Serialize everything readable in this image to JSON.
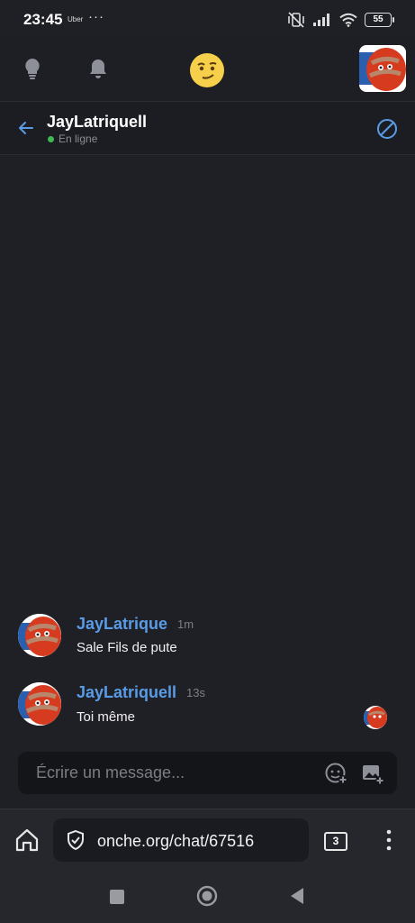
{
  "status_bar": {
    "time": "23:45",
    "carrier": "Uber",
    "more": "···",
    "battery": "55"
  },
  "top_bar": {
    "icons": [
      "lightbulb-icon",
      "bell-icon",
      "site-logo-emoji",
      "user-avatar"
    ]
  },
  "chat_header": {
    "title": "JayLatriquell",
    "status": "En ligne",
    "status_color": "#3fb950",
    "accent": "#5a9be6"
  },
  "messages": [
    {
      "author": "JayLatrique",
      "time": "1m",
      "text": "Sale Fils de pute"
    },
    {
      "author": "JayLatriquell",
      "time": "13s",
      "text": "Toi même"
    }
  ],
  "composer": {
    "placeholder": "Écrire un message..."
  },
  "browser": {
    "url": "onche.org/chat/67516",
    "tab_count": "3"
  }
}
